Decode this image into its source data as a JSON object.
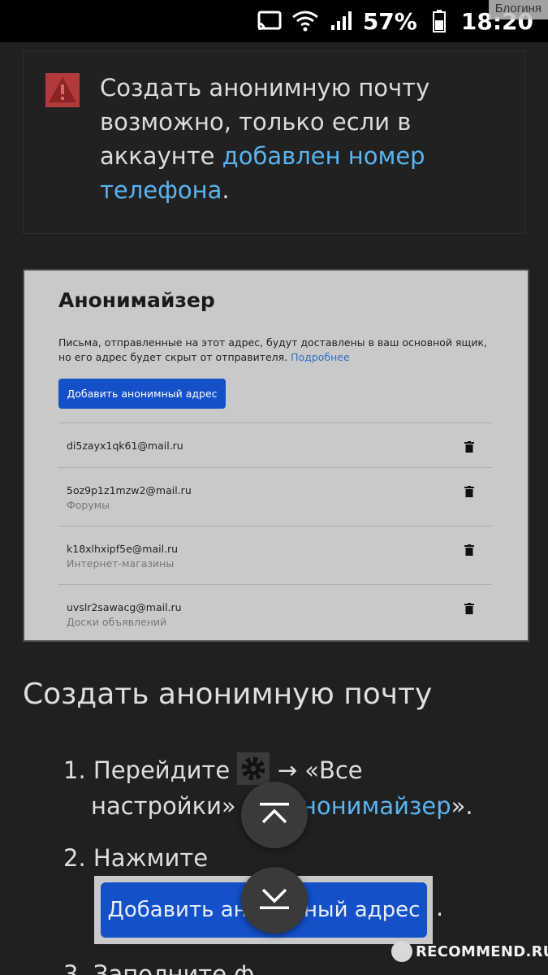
{
  "status_bar": {
    "battery": "57%",
    "time": "18:20",
    "watermark": "Блогиня"
  },
  "notice": {
    "text_before": "Создать анонимную почту возможно, только если в аккаунте ",
    "link": "добавлен номер телефона",
    "text_after": "."
  },
  "anonymizer": {
    "title": "Анонимайзер",
    "description": "Письма, отправленные на этот адрес, будут доставлены в ваш основной ящик, но его адрес будет скрыт от отправителя.",
    "details_link": "Подробнее",
    "add_button": "Добавить анонимный адрес",
    "addresses": [
      {
        "email": "di5zayx1qk61@mail.ru",
        "tag": ""
      },
      {
        "email": "5oz9p1z1mzw2@mail.ru",
        "tag": "Форумы"
      },
      {
        "email": "k18xlhxipf5e@mail.ru",
        "tag": "Интернет-магазины"
      },
      {
        "email": "uvslr2sawacg@mail.ru",
        "tag": "Доски объявлений"
      }
    ]
  },
  "section": {
    "title": "Создать анонимную почту",
    "step1_a": "1. Перейдите ",
    "step1_b": " → «Все",
    "step1_c": "настройки» → «",
    "step1_link": "Анонимайзер",
    "step1_d": "».",
    "step2": "2. Нажмите",
    "step2_button": "Добавить анонимный адрес",
    "step2_after": ".",
    "step3": "3. Заполните ф"
  },
  "site_badge": "RECOMMEND.RU",
  "colors": {
    "background": "#202020",
    "link": "#5ab4f0",
    "button_blue": "#1450c8",
    "warning": "#b23a3a"
  }
}
